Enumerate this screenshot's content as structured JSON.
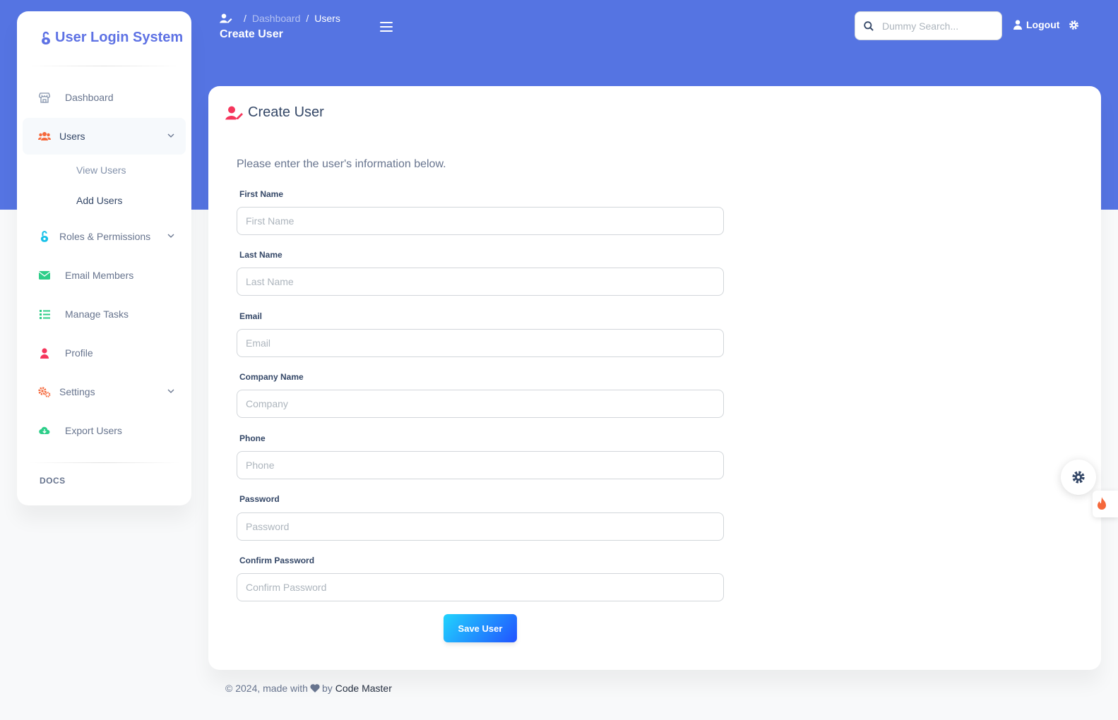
{
  "brand": {
    "name": "User Login System",
    "icon": "lock-open-icon",
    "color": "#5e72e4"
  },
  "header": {
    "breadcrumb": {
      "icon": "user-edit-icon",
      "parent": "Dashboard",
      "separator": "/",
      "current": "Users"
    },
    "title": "Create User",
    "search_placeholder": "Dummy Search...",
    "logout_label": "Logout",
    "accent": "#5574e2"
  },
  "sidebar": {
    "items": [
      {
        "label": "Dashboard",
        "icon": "shop-icon",
        "active": false
      },
      {
        "label": "Users",
        "icon": "users-icon",
        "active": true,
        "expandable": true
      },
      {
        "label": "Roles & Permissions",
        "icon": "lock-open-icon",
        "expandable": true
      },
      {
        "label": "Email Members",
        "icon": "envelope-icon"
      },
      {
        "label": "Manage Tasks",
        "icon": "list-icon"
      },
      {
        "label": "Profile",
        "icon": "user-icon"
      },
      {
        "label": "Settings",
        "icon": "cogs-icon",
        "expandable": true
      },
      {
        "label": "Export Users",
        "icon": "cloud-download-icon"
      }
    ],
    "sub_items": [
      {
        "label": "View Users",
        "active": false
      },
      {
        "label": "Add Users",
        "active": true
      }
    ],
    "section_label": "DOCS"
  },
  "card": {
    "title": "Create User",
    "title_icon": "user-edit-icon",
    "intro": "Please enter the user's information below.",
    "fields": [
      {
        "label": "First Name",
        "placeholder": "First Name",
        "value": ""
      },
      {
        "label": "Last Name",
        "placeholder": "Last Name",
        "value": ""
      },
      {
        "label": "Email",
        "placeholder": "Email",
        "value": ""
      },
      {
        "label": "Company Name",
        "placeholder": "Company",
        "value": ""
      },
      {
        "label": "Phone",
        "placeholder": "Phone",
        "value": ""
      },
      {
        "label": "Password",
        "placeholder": "Password",
        "value": ""
      },
      {
        "label": "Confirm Password",
        "placeholder": "Confirm Password",
        "value": ""
      }
    ],
    "submit_label": "Save User"
  },
  "footer": {
    "prefix": "© 2024, made with",
    "icon": "heart-icon",
    "by": "by",
    "author": "Code Master"
  }
}
